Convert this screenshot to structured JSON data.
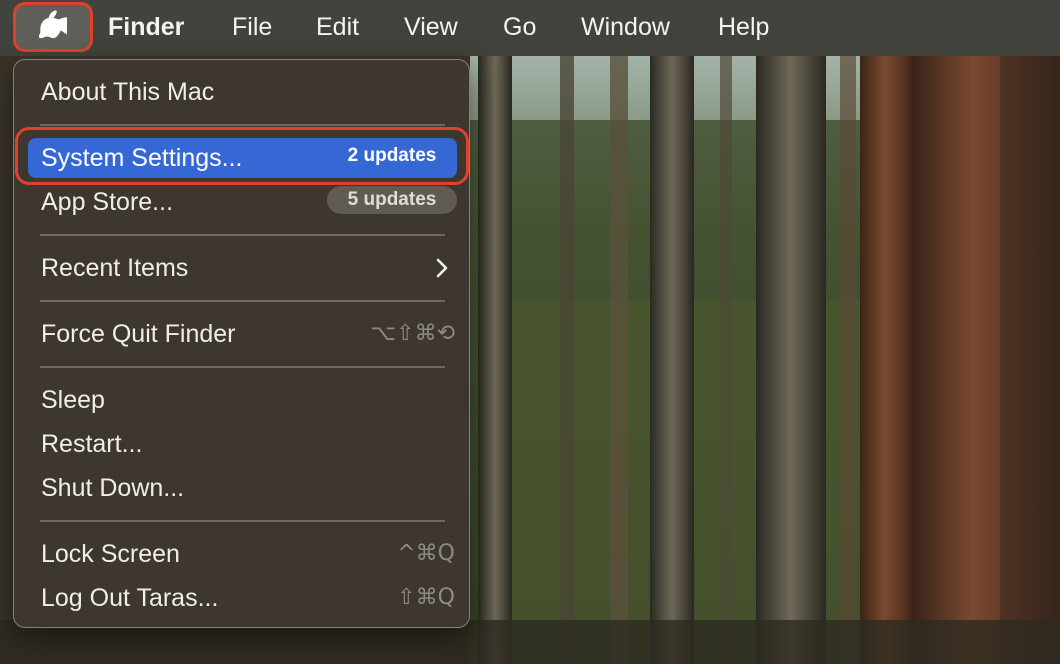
{
  "menubar": {
    "apple_icon": "apple-logo-icon",
    "items": [
      "Finder",
      "File",
      "Edit",
      "View",
      "Go",
      "Window",
      "Help"
    ]
  },
  "apple_menu": {
    "about": "About This Mac",
    "system_settings": {
      "label": "System Settings...",
      "badge": "2 updates"
    },
    "app_store": {
      "label": "App Store...",
      "badge": "5 updates"
    },
    "recent_items": {
      "label": "Recent Items",
      "icon": "chevron-right-icon"
    },
    "force_quit": {
      "label": "Force Quit Finder",
      "shortcut": "⌥⇧⌘⟲"
    },
    "sleep": "Sleep",
    "restart": "Restart...",
    "shut_down": "Shut Down...",
    "lock_screen": {
      "label": "Lock Screen",
      "shortcut": "^⌘Q"
    },
    "log_out": {
      "label": "Log Out Taras...",
      "shortcut": "⇧⌘Q"
    }
  },
  "colors": {
    "highlight": "#3568d4",
    "annotation_outline": "#e0412c"
  }
}
